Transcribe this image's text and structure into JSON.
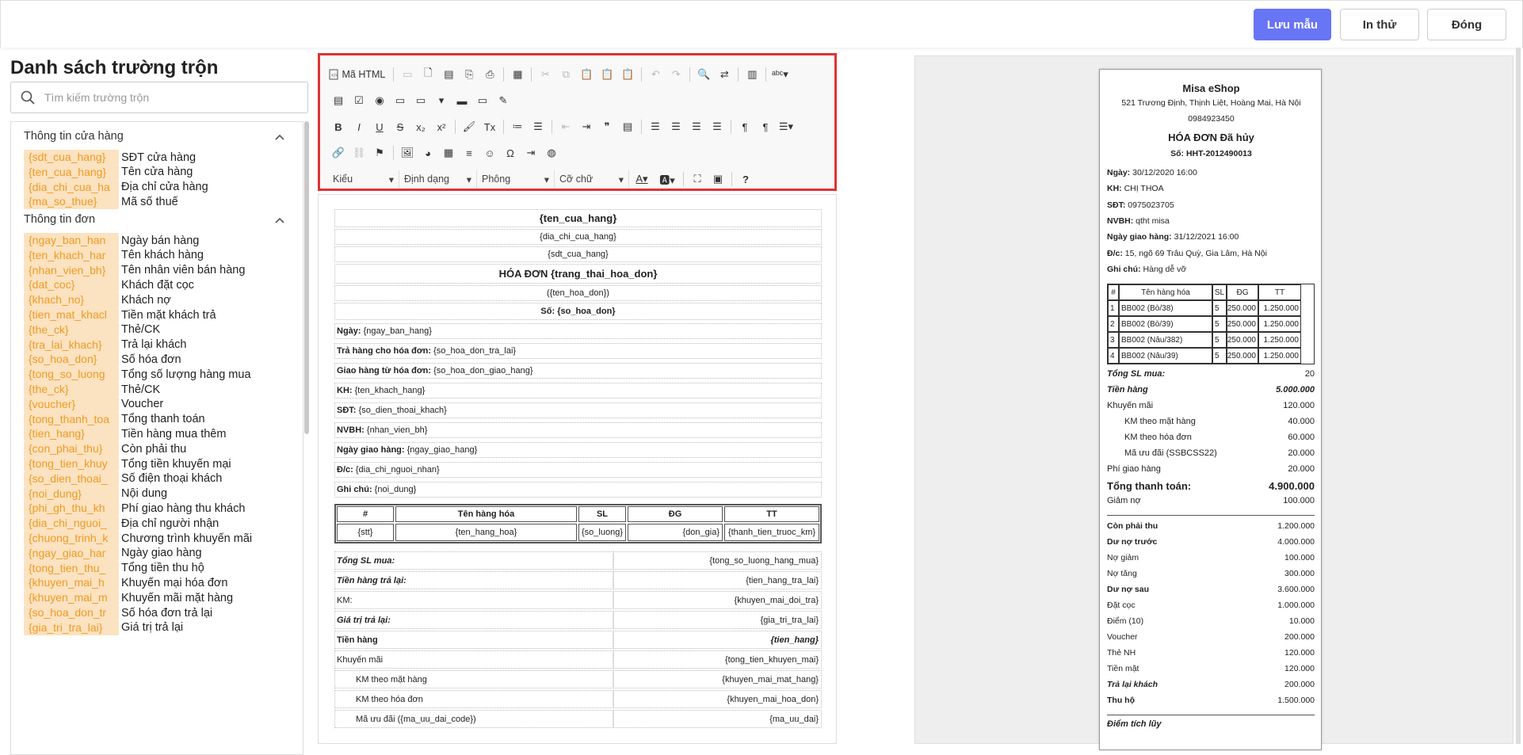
{
  "header": {
    "save": "Lưu mẫu",
    "print": "In thử",
    "close": "Đóng"
  },
  "left": {
    "title": "Danh sách trường trộn",
    "search_placeholder": "Tìm kiếm trường trộn",
    "group1": "Thông tin cửa hàng",
    "store_fields": [
      [
        "{sdt_cua_hang}",
        "SĐT cửa hàng"
      ],
      [
        "{ten_cua_hang}",
        "Tên cửa hàng"
      ],
      [
        "{dia_chi_cua_ha",
        "Địa chỉ cửa hàng"
      ],
      [
        "{ma_so_thue}",
        "Mã số thuế"
      ]
    ],
    "group2": "Thông tin đơn",
    "order_fields": [
      [
        "{ngay_ban_han",
        "Ngày bán hàng"
      ],
      [
        "{ten_khach_har",
        "Tên khách hàng"
      ],
      [
        "{nhan_vien_bh}",
        "Tên nhân viên bán hàng"
      ],
      [
        "{dat_coc}",
        "Khách đặt cọc"
      ],
      [
        "{khach_no}",
        "Khách nợ"
      ],
      [
        "{tien_mat_khacl",
        "Tiền mặt khách trả"
      ],
      [
        "{the_ck}",
        "Thẻ/CK"
      ],
      [
        "{tra_lai_khach}",
        "Trả lại khách"
      ],
      [
        "{so_hoa_don}",
        "Số hóa đơn"
      ],
      [
        "{tong_so_luong",
        "Tổng số lượng hàng mua"
      ],
      [
        "{the_ck}",
        "Thẻ/CK"
      ],
      [
        "{voucher}",
        "Voucher"
      ],
      [
        "{tong_thanh_toa",
        "Tổng thanh toán"
      ],
      [
        "{tien_hang}",
        "Tiền hàng mua thêm"
      ],
      [
        "{con_phai_thu}",
        "Còn phải thu"
      ],
      [
        "{tong_tien_khuy",
        "Tổng tiền khuyến mại"
      ],
      [
        "{so_dien_thoai_",
        "Số điện thoại khách"
      ],
      [
        "{noi_dung}",
        "Nội dung"
      ],
      [
        "{phi_gh_thu_kh",
        "Phí giao hàng thu khách"
      ],
      [
        "{dia_chi_nguoi_",
        "Địa chỉ người nhận"
      ],
      [
        "{chuong_trinh_k",
        "Chương trình khuyến mãi"
      ],
      [
        "{ngay_giao_har",
        "Ngày giao hàng"
      ],
      [
        "{tong_tien_thu_",
        "Tổng tiền thu hộ"
      ],
      [
        "{khuyen_mai_h",
        "Khuyến mại hóa đơn"
      ],
      [
        "{khuyen_mai_m",
        "Khuyến mãi mặt hàng"
      ],
      [
        "{so_hoa_don_tr",
        "Số hóa đơn trả lại"
      ],
      [
        "{gia_tri_tra_lai}",
        "Giá trị trả lại"
      ]
    ]
  },
  "toolbar": {
    "html": "Mã HTML",
    "style": "Kiểu",
    "format": "Định dạng",
    "font": "Phông",
    "size": "Cỡ chữ"
  },
  "template": {
    "store": "{ten_cua_hang}",
    "addr": "{dia_chi_cua_hang}",
    "phone": "{sdt_cua_hang}",
    "title": "HÓA ĐƠN {trang_thai_hoa_don}",
    "name": "({ten_hoa_don})",
    "no_label": "Số:",
    "no": "{so_hoa_don}",
    "info": [
      [
        "Ngày:",
        "{ngay_ban_hang}"
      ],
      [
        "Trả hàng cho hóa đơn:",
        "{so_hoa_don_tra_lai}"
      ],
      [
        "Giao hàng từ hóa đơn:",
        "{so_hoa_don_giao_hang}"
      ],
      [
        "KH:",
        "{ten_khach_hang}"
      ],
      [
        "SĐT:",
        "{so_dien_thoai_khach}"
      ],
      [
        "NVBH:",
        "{nhan_vien_bh}"
      ],
      [
        "Ngày giao hàng:",
        "{ngay_giao_hang}"
      ],
      [
        "Đ/c:",
        "{dia_chi_nguoi_nhan}"
      ],
      [
        "Ghi chú:",
        "{noi_dung}"
      ]
    ],
    "cols": [
      "#",
      "Tên hàng hóa",
      "SL",
      "ĐG",
      "TT"
    ],
    "row": [
      "{stt}",
      "{ten_hang_hoa}",
      "{so_luong}",
      "{don_gia}",
      "{thanh_tien_truoc_km}"
    ],
    "summary": [
      [
        "Tổng SL mua:",
        "{tong_so_luong_hang_mua}"
      ],
      [
        "Tiền hàng trả lại:",
        "{tien_hang_tra_lai}"
      ],
      [
        "KM:",
        "{khuyen_mai_doi_tra}"
      ],
      [
        "Giá trị trả lại:",
        "{gia_tri_tra_lai}"
      ],
      [
        "Tiền hàng",
        "{tien_hang}"
      ],
      [
        "Khuyến mãi",
        "{tong_tien_khuyen_mai}"
      ],
      [
        "KM theo mặt hàng",
        "{khuyen_mai_mat_hang}"
      ],
      [
        "KM theo hóa đơn",
        "{khuyen_mai_hoa_don}"
      ],
      [
        "Mã ưu đãi ({ma_uu_dai_code})",
        "{ma_uu_dai}"
      ]
    ]
  },
  "preview": {
    "shop": "Misa eShop",
    "addr": "521 Trương Định, Thịnh Liệt, Hoàng Mai, Hà Nội",
    "phone": "0984923450",
    "title": "HÓA ĐƠN Đã hủy",
    "no": "Số: HHT-2012490013",
    "info": [
      [
        "Ngày:",
        "30/12/2020 16:00"
      ],
      [
        "KH:",
        "CHỊ THOA"
      ],
      [
        "SĐT:",
        "0975023705"
      ],
      [
        "NVBH:",
        "qtht misa"
      ],
      [
        "Ngày giao hàng:",
        "31/12/2021 16:00"
      ],
      [
        "Đ/c:",
        "15, ngõ 69 Trâu Quỳ, Gia Lâm, Hà Nội"
      ],
      [
        "Ghi chú:",
        "Hàng dễ vỡ"
      ]
    ],
    "cols": [
      "#",
      "Tên hàng hóa",
      "SL",
      "ĐG",
      "TT"
    ],
    "rows": [
      [
        "1",
        "BB002 (Bò/38)",
        "5",
        "250.000",
        "1.250.000"
      ],
      [
        "2",
        "BB002 (Bò/39)",
        "5",
        "250.000",
        "1.250.000"
      ],
      [
        "3",
        "BB002 (Nâu/382)",
        "5",
        "250.000",
        "1.250.000"
      ],
      [
        "4",
        "BB002 (Nâu/39)",
        "5",
        "250.000",
        "1.250.000"
      ]
    ],
    "sum1": [
      [
        "Tổng SL mua:",
        "20"
      ],
      [
        "Tiền hàng",
        "5.000.000"
      ],
      [
        "Khuyến mãi",
        "120.000"
      ],
      [
        "KM theo mặt hàng",
        "40.000"
      ],
      [
        "KM theo hóa đơn",
        "60.000"
      ],
      [
        "Mã ưu đãi (SSBCSS22)",
        "20.000"
      ],
      [
        "Phí giao hàng",
        "20.000"
      ],
      [
        "Tổng thanh toán:",
        "4.900.000"
      ],
      [
        "Giảm nợ",
        "100.000"
      ]
    ],
    "sum2": [
      [
        "Còn phải thu",
        "1.200.000"
      ],
      [
        "Dư nợ trước",
        "4.000.000"
      ],
      [
        "Nợ giảm",
        "100.000"
      ],
      [
        "Nợ tăng",
        "300.000"
      ],
      [
        "Dư nợ sau",
        "3.600.000"
      ],
      [
        "Đặt cọc",
        "1.000.000"
      ],
      [
        "Điểm (10)",
        "10.000"
      ],
      [
        "Voucher",
        "200.000"
      ],
      [
        "Thẻ NH",
        "120.000"
      ],
      [
        "Tiền mặt",
        "120.000"
      ],
      [
        "Trả lại khách",
        "200.000"
      ],
      [
        "Thu hộ",
        "1.500.000"
      ]
    ],
    "points": "Điểm tích lũy"
  }
}
